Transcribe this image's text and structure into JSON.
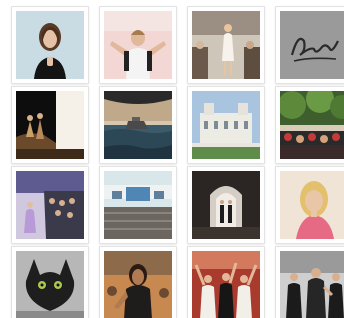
{
  "gallery": {
    "thumbnails": [
      {
        "subject": "woman-dark-hair-hands-together"
      },
      {
        "subject": "man-arms-spread-white-tshirt"
      },
      {
        "subject": "runway-model-white-dress"
      },
      {
        "subject": "handwritten-autograph"
      },
      {
        "subject": "stage-performers-silhouette"
      },
      {
        "subject": "boat-on-stormy-sea"
      },
      {
        "subject": "white-palace-building-crowd"
      },
      {
        "subject": "crowd-under-trees-red-lights"
      },
      {
        "subject": "runway-show-purple-light"
      },
      {
        "subject": "open-air-stage-audience"
      },
      {
        "subject": "runway-models-spotlight-arch"
      },
      {
        "subject": "blonde-woman-smiling-pink"
      },
      {
        "subject": "toothless-dragon-figure"
      },
      {
        "subject": "fashion-model-dark-skirt"
      },
      {
        "subject": "dancers-on-stage-cheering"
      },
      {
        "subject": "man-suit-pointing-event"
      }
    ]
  }
}
